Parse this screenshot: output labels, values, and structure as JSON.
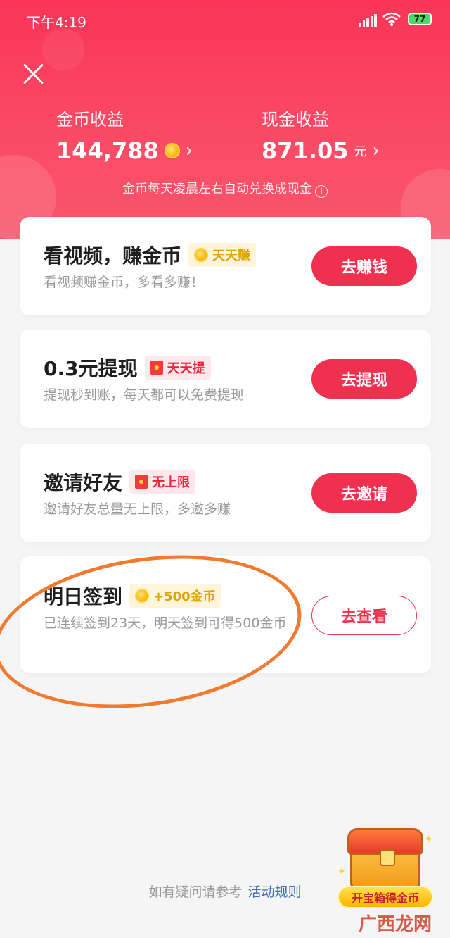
{
  "status_bar": {
    "time": "下午4:19",
    "battery": "77"
  },
  "header": {
    "coin_income_label": "金币收益",
    "coin_income_value": "144,788",
    "cash_income_label": "现金收益",
    "cash_income_value": "871.05",
    "cash_unit": "元",
    "note": "金币每天凌晨左右自动兑换成现金",
    "chevron": "›",
    "info_icon": "i"
  },
  "tasks": [
    {
      "title": "看视频，赚金币",
      "tag": "天天赚",
      "subtitle": "看视频赚金币，多看多赚！",
      "button": "去赚钱"
    },
    {
      "title": "0.3元提现",
      "tag": "天天提",
      "subtitle": "提现秒到账，每天都可以免费提现",
      "button": "去提现"
    },
    {
      "title": "邀请好友",
      "tag": "无上限",
      "subtitle": "邀请好友总量无上限，多邀多赚",
      "button": "去邀请"
    },
    {
      "title": "明日签到",
      "tag": "+500金币",
      "subtitle": "已连续签到23天，明天签到可得500金币",
      "button": "去查看"
    }
  ],
  "footer": {
    "text": "如有疑问请参考",
    "link": "活动规则"
  },
  "treasure_chest": {
    "label": "开宝箱得金币"
  },
  "watermark": "广西龙网",
  "colors": {
    "primary": "#f0304f",
    "header": "#fa3458",
    "annotation": "#f27a2e",
    "link": "#3d6fb4"
  }
}
